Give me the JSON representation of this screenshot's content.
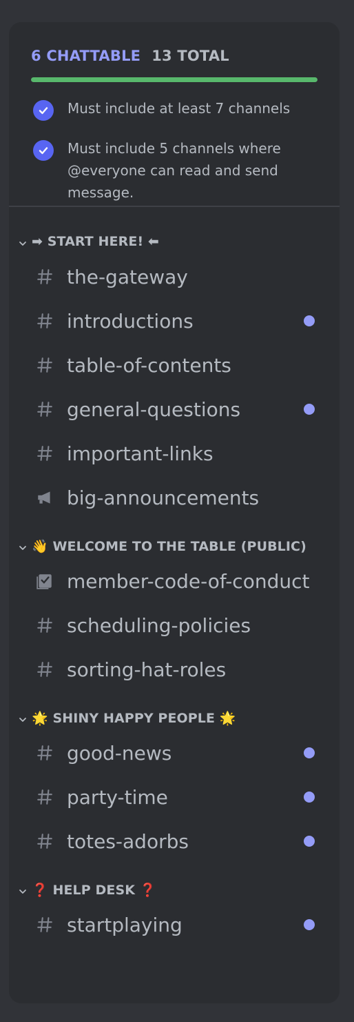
{
  "summary": {
    "chattable": "6 CHATTABLE",
    "total": "13 TOTAL",
    "progress": 1.0,
    "requirements": [
      "Must include at least 7 channels",
      "Must include 5 channels where @everyone can read and send message."
    ]
  },
  "categories": [
    {
      "label": "➡ START HERE! ⬅",
      "channels": [
        {
          "name": "the-gateway",
          "icon": "hashtag-icon",
          "unread": false
        },
        {
          "name": "introductions",
          "icon": "hashtag-icon",
          "unread": true
        },
        {
          "name": "table-of-contents",
          "icon": "hashtag-icon",
          "unread": false
        },
        {
          "name": "general-questions",
          "icon": "hashtag-icon",
          "unread": true
        },
        {
          "name": "important-links",
          "icon": "hashtag-icon",
          "unread": false
        },
        {
          "name": "big-announcements",
          "icon": "megaphone-icon",
          "unread": false
        }
      ]
    },
    {
      "label": "👋 WELCOME TO THE TABLE (PUBLIC)",
      "channels": [
        {
          "name": "member-code-of-conduct",
          "icon": "rules-icon",
          "unread": false
        },
        {
          "name": "scheduling-policies",
          "icon": "hashtag-icon",
          "unread": false
        },
        {
          "name": "sorting-hat-roles",
          "icon": "hashtag-icon",
          "unread": false
        }
      ]
    },
    {
      "label": "🌟 SHINY HAPPY PEOPLE 🌟",
      "channels": [
        {
          "name": "good-news",
          "icon": "hashtag-icon",
          "unread": true
        },
        {
          "name": "party-time",
          "icon": "hashtag-icon",
          "unread": true
        },
        {
          "name": "totes-adorbs",
          "icon": "hashtag-icon",
          "unread": true
        }
      ]
    },
    {
      "label": "❓ HELP DESK ❓",
      "channels": [
        {
          "name": "startplaying",
          "icon": "hashtag-icon",
          "unread": true
        }
      ]
    }
  ],
  "colors": {
    "accent": "#949cf7",
    "progress": "#58b86c",
    "check": "#5865f2"
  }
}
